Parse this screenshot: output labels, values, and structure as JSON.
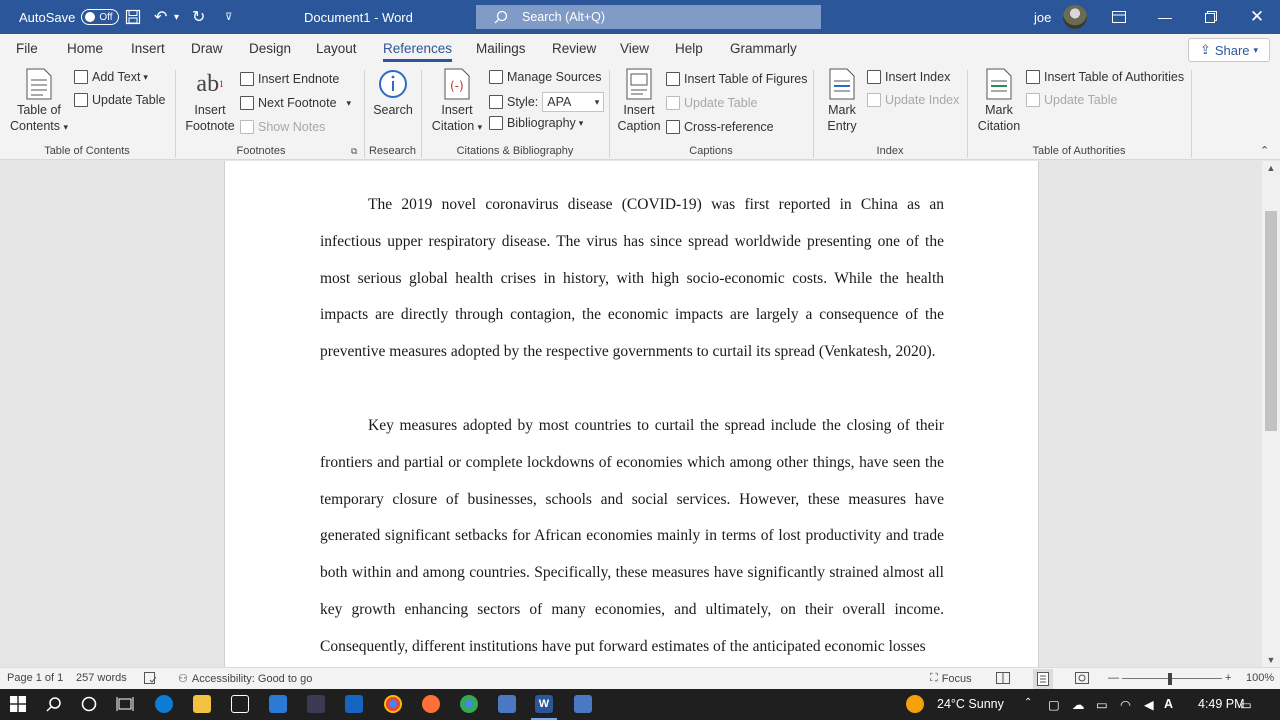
{
  "titlebar": {
    "autosave_label": "AutoSave",
    "autosave_state": "Off",
    "doc_title": "Document1  -  Word",
    "search_placeholder": "Search (Alt+Q)",
    "user_name": "joe"
  },
  "menu": {
    "tabs": [
      "File",
      "Home",
      "Insert",
      "Draw",
      "Design",
      "Layout",
      "References",
      "Mailings",
      "Review",
      "View",
      "Help",
      "Grammarly"
    ],
    "active_tab": "References",
    "share_label": "Share"
  },
  "ribbon": {
    "toc": {
      "big_label_1": "Table of",
      "big_label_2": "Contents",
      "add_text": "Add Text",
      "update_table": "Update Table",
      "group_label": "Table of Contents"
    },
    "footnotes": {
      "big_label_1": "Insert",
      "big_label_2": "Footnote",
      "insert_endnote": "Insert Endnote",
      "next_footnote": "Next Footnote",
      "show_notes": "Show Notes",
      "group_label": "Footnotes"
    },
    "research": {
      "search": "Search",
      "group_label": "Research"
    },
    "citations": {
      "big_label_1": "Insert",
      "big_label_2": "Citation",
      "manage_sources": "Manage Sources",
      "style_label": "Style:",
      "style_value": "APA",
      "bibliography": "Bibliography",
      "group_label": "Citations & Bibliography"
    },
    "captions": {
      "big_label_1": "Insert",
      "big_label_2": "Caption",
      "insert_tof": "Insert Table of Figures",
      "update_table": "Update Table",
      "cross_reference": "Cross-reference",
      "group_label": "Captions"
    },
    "index": {
      "big_label_1": "Mark",
      "big_label_2": "Entry",
      "insert_index": "Insert Index",
      "update_index": "Update Index",
      "group_label": "Index"
    },
    "toa": {
      "big_label_1": "Mark",
      "big_label_2": "Citation",
      "insert_toa": "Insert Table of Authorities",
      "update_table": "Update Table",
      "group_label": "Table of Authorities"
    }
  },
  "document": {
    "paragraph_1": "The 2019 novel coronavirus disease (COVID-19) was first reported in China as an infectious upper respiratory disease. The virus has since spread worldwide presenting one of the most serious global health crises in history, with high socio-economic costs. While the health impacts are directly through contagion, the economic impacts are largely a consequence of the preventive measures adopted by the respective governments to curtail its spread (Venkatesh, 2020).",
    "paragraph_2": "Key measures adopted by most countries to curtail the spread include the closing of their frontiers and partial or complete lockdowns of economies which among other things, have seen the temporary closure of businesses, schools and social services. However, these measures have generated significant setbacks for African economies mainly in terms of lost productivity and trade both within and among countries. Specifically, these measures have significantly strained almost all key growth enhancing sectors of many economies, and ultimately, on their overall income. Consequently, different institutions have put forward estimates of the anticipated economic losses"
  },
  "status": {
    "page": "Page 1 of 1",
    "words": "257 words",
    "accessibility": "Accessibility: Good to go",
    "focus": "Focus",
    "zoom": "100%"
  },
  "taskbar": {
    "weather": "24°C  Sunny",
    "time": "4:49 PM"
  },
  "colors": {
    "word_blue": "#2b579a"
  }
}
